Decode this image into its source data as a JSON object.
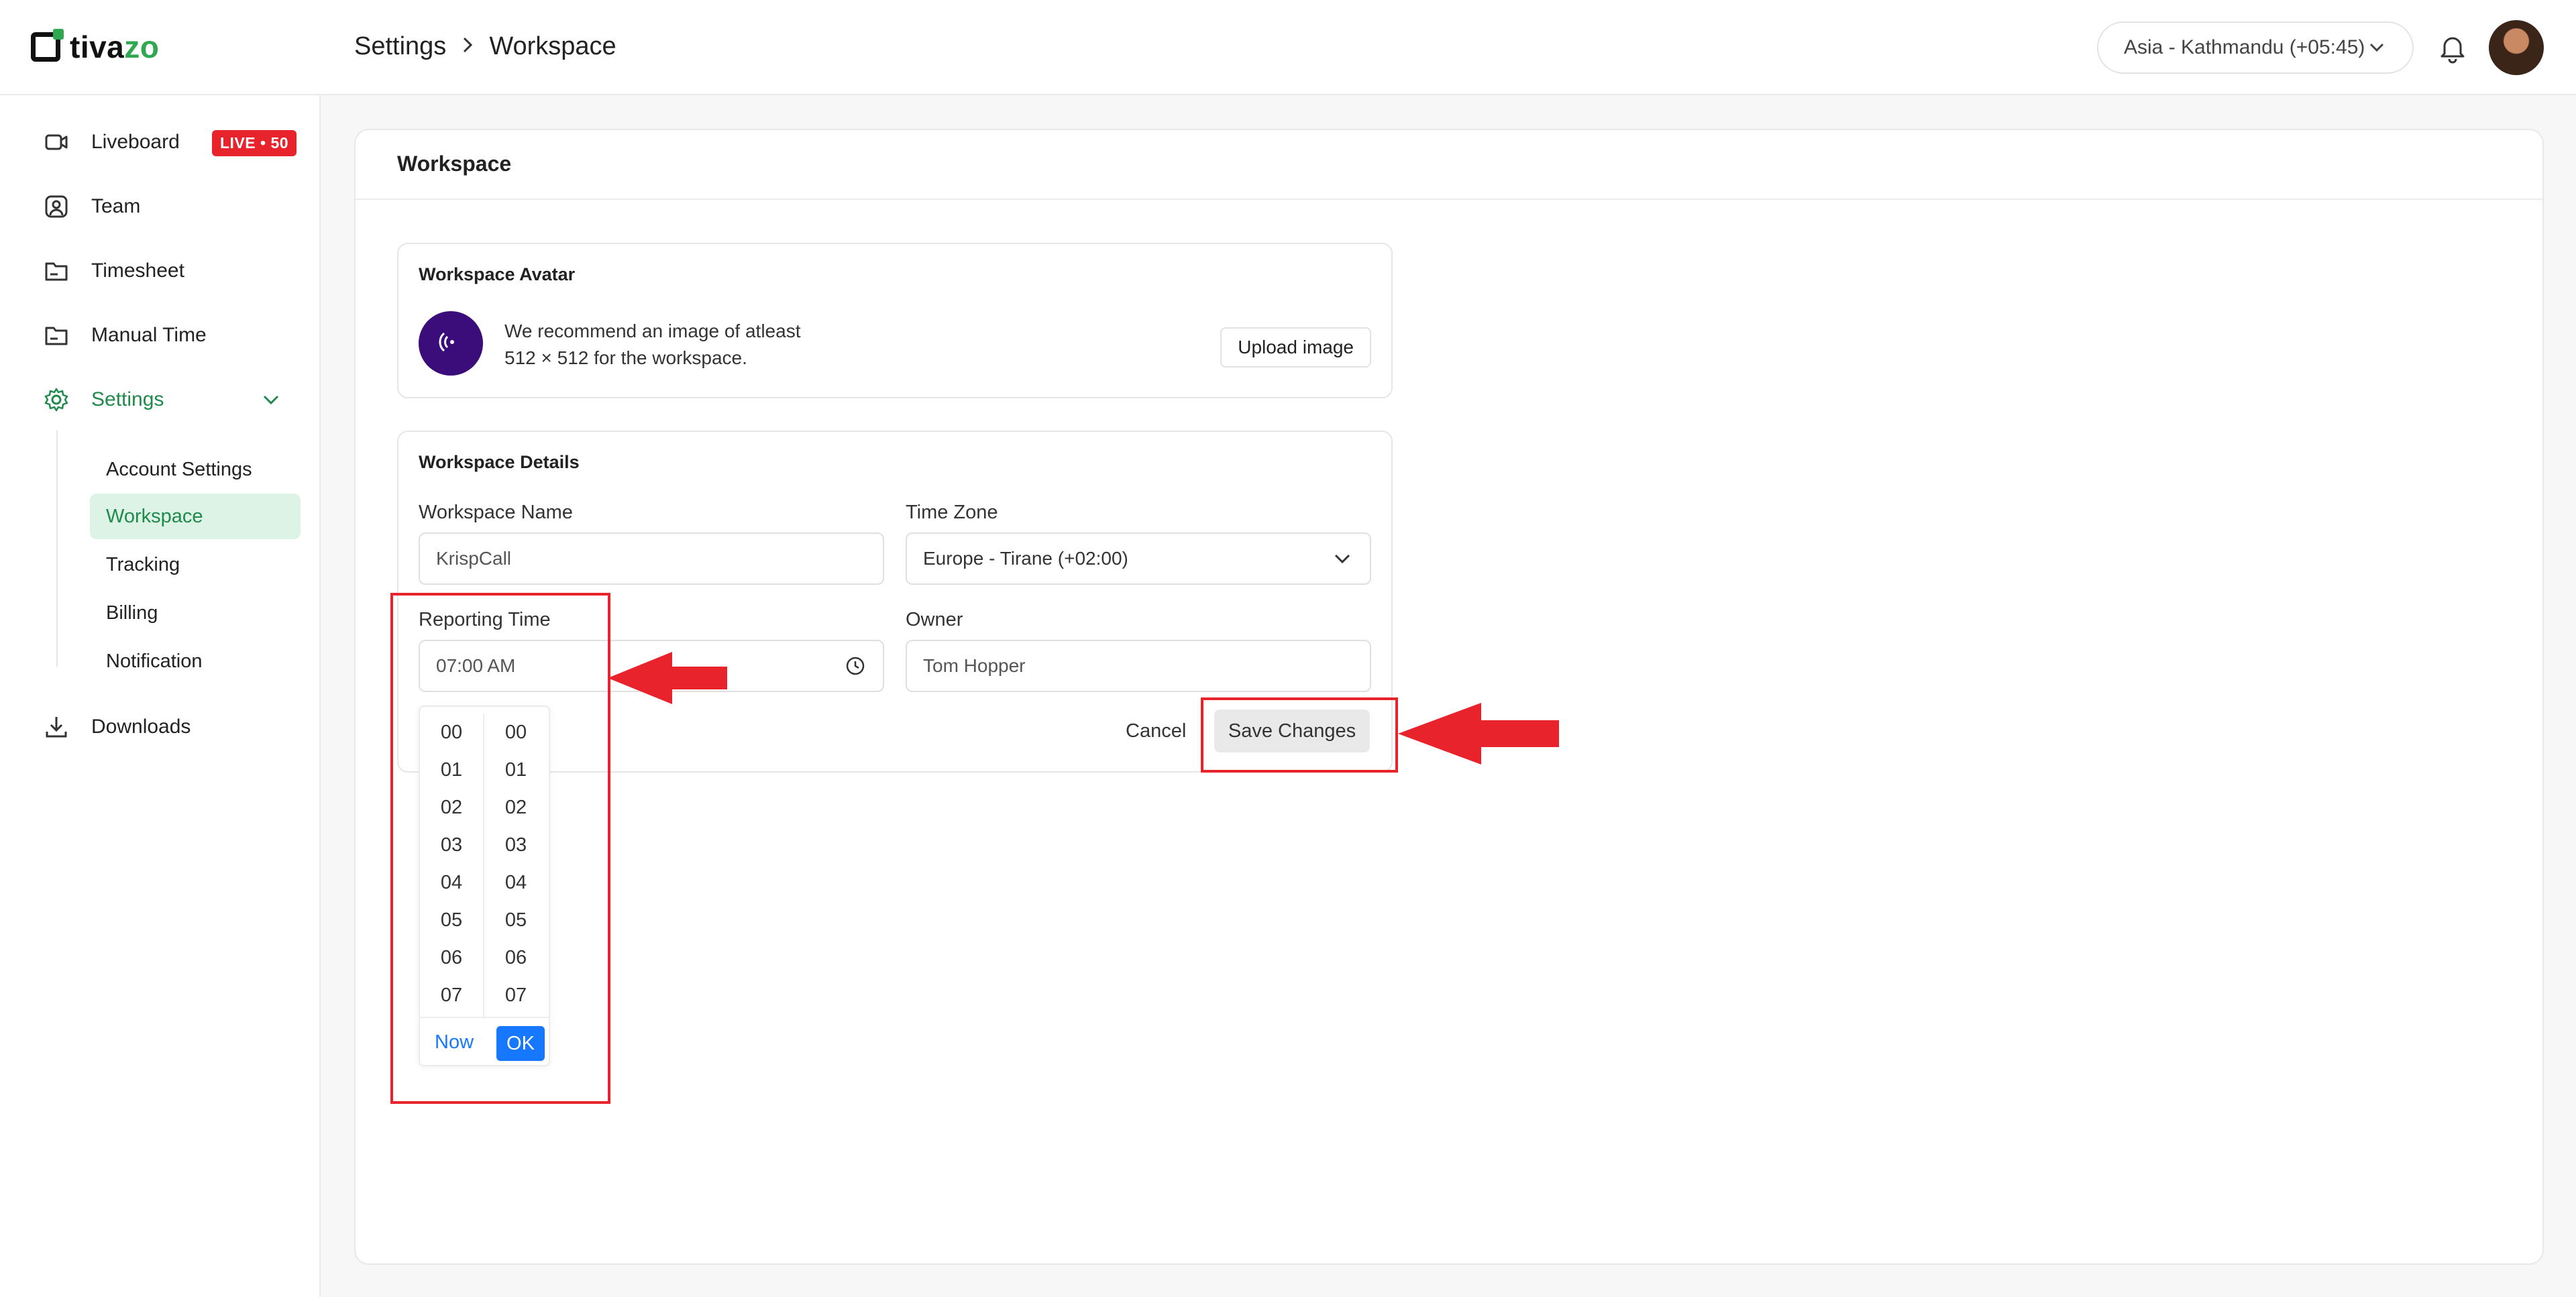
{
  "header": {
    "logo": {
      "text_main": "tiva",
      "text_accent": "zo"
    },
    "breadcrumb": {
      "parent": "Settings",
      "current": "Workspace"
    },
    "timezone": "Asia - Kathmandu (+05:45)"
  },
  "sidebar": {
    "items": [
      {
        "label": "Liveboard",
        "badge": "LIVE • 50"
      },
      {
        "label": "Team"
      },
      {
        "label": "Timesheet"
      },
      {
        "label": "Manual Time"
      },
      {
        "label": "Settings"
      },
      {
        "label": "Downloads"
      }
    ],
    "settings_sub": [
      {
        "label": "Account Settings"
      },
      {
        "label": "Workspace"
      },
      {
        "label": "Tracking"
      },
      {
        "label": "Billing"
      },
      {
        "label": "Notification"
      }
    ]
  },
  "main": {
    "title": "Workspace",
    "avatar_panel": {
      "title": "Workspace Avatar",
      "recommend_line1": "We recommend an image of atleast",
      "recommend_line2": "512 × 512 for the workspace.",
      "upload_label": "Upload image"
    },
    "details_panel": {
      "title": "Workspace Details",
      "name_label": "Workspace Name",
      "name_value": "KrispCall",
      "timezone_label": "Time Zone",
      "timezone_value": "Europe - Tirane (+02:00)",
      "reporting_label": "Reporting Time",
      "reporting_value": "07:00 AM",
      "owner_label": "Owner",
      "owner_value": "Tom Hopper",
      "cancel_label": "Cancel",
      "save_label": "Save Changes"
    },
    "time_picker": {
      "hours": [
        "00",
        "01",
        "02",
        "03",
        "04",
        "05",
        "06",
        "07"
      ],
      "minutes": [
        "00",
        "01",
        "02",
        "03",
        "04",
        "05",
        "06",
        "07"
      ],
      "now_label": "Now",
      "ok_label": "OK"
    }
  },
  "colors": {
    "brand_green": "#2fa84f",
    "active_green": "#1f8a4c",
    "active_bg": "#ddf3e6",
    "live_red": "#e8232c",
    "ok_blue": "#1677ff",
    "workspace_avatar": "#3a0d7a",
    "annotation_red": "#e8232c"
  }
}
